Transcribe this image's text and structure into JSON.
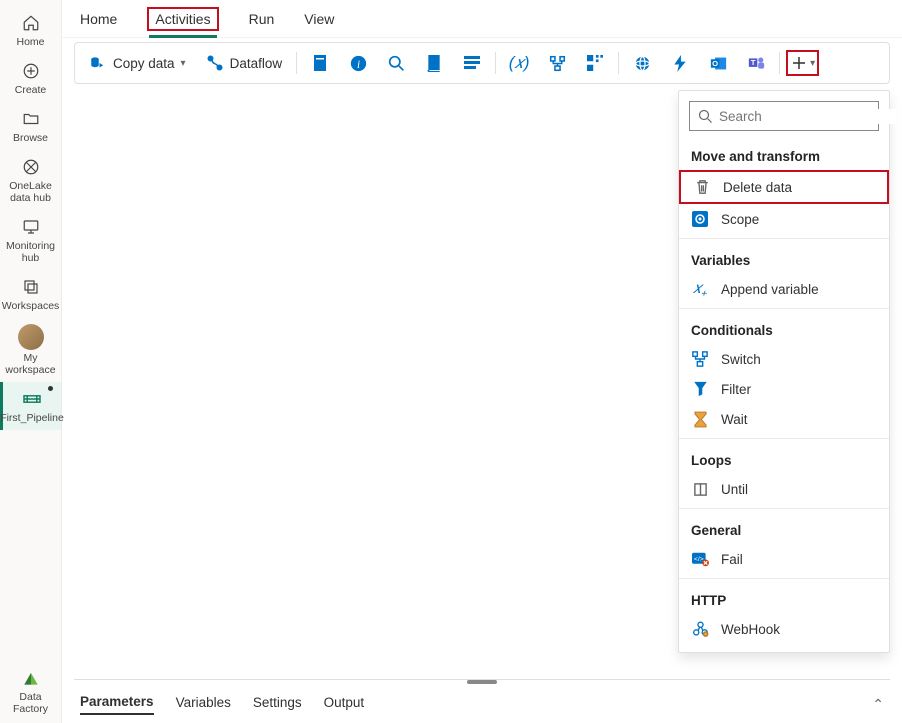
{
  "rail": {
    "items": [
      {
        "label": "Home",
        "icon": "home"
      },
      {
        "label": "Create",
        "icon": "plus-circle"
      },
      {
        "label": "Browse",
        "icon": "folder"
      },
      {
        "label": "OneLake data hub",
        "icon": "onelake"
      },
      {
        "label": "Monitoring hub",
        "icon": "monitor"
      },
      {
        "label": "Workspaces",
        "icon": "stack"
      },
      {
        "label": "My workspace",
        "icon": "avatar"
      },
      {
        "label": "First_Pipeline",
        "icon": "pipeline",
        "active": true
      }
    ],
    "footer": {
      "label": "Data Factory",
      "icon": "data-factory"
    }
  },
  "tabs": [
    {
      "label": "Home"
    },
    {
      "label": "Activities",
      "active": true,
      "highlighted": true
    },
    {
      "label": "Run"
    },
    {
      "label": "View"
    }
  ],
  "toolbar": {
    "copy": {
      "label": "Copy data"
    },
    "dataflow": {
      "label": "Dataflow"
    }
  },
  "dropdown": {
    "search_placeholder": "Search",
    "sections": [
      {
        "title": "Move and transform",
        "items": [
          {
            "label": "Delete data",
            "icon": "trash",
            "highlighted": true
          },
          {
            "label": "Scope",
            "icon": "scope"
          }
        ]
      },
      {
        "title": "Variables",
        "items": [
          {
            "label": "Append variable",
            "icon": "append-var"
          }
        ]
      },
      {
        "title": "Conditionals",
        "items": [
          {
            "label": "Switch",
            "icon": "switch"
          },
          {
            "label": "Filter",
            "icon": "funnel"
          },
          {
            "label": "Wait",
            "icon": "hourglass"
          }
        ]
      },
      {
        "title": "Loops",
        "items": [
          {
            "label": "Until",
            "icon": "loop"
          }
        ]
      },
      {
        "title": "General",
        "items": [
          {
            "label": "Fail",
            "icon": "fail"
          }
        ]
      },
      {
        "title": "HTTP",
        "items": [
          {
            "label": "WebHook",
            "icon": "webhook"
          }
        ]
      }
    ]
  },
  "bottomPanel": {
    "tabs": [
      {
        "label": "Parameters",
        "active": true
      },
      {
        "label": "Variables"
      },
      {
        "label": "Settings"
      },
      {
        "label": "Output"
      }
    ]
  }
}
